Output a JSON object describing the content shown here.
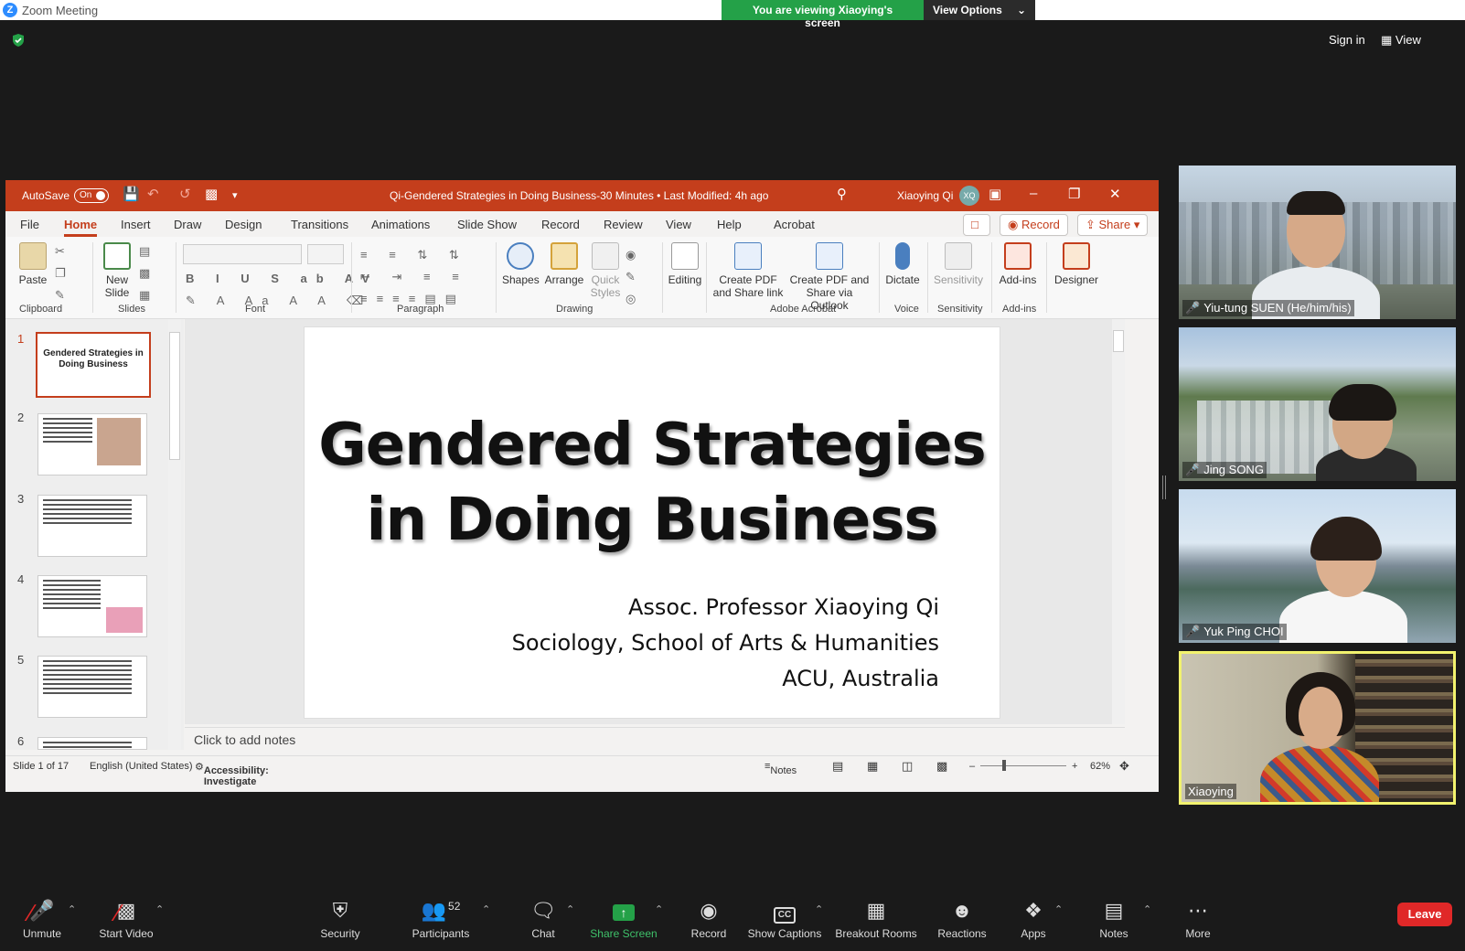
{
  "zoom": {
    "window_title": "Zoom Meeting",
    "viewing_banner": "You are viewing Xiaoying's screen",
    "view_options": "View Options",
    "sign_in": "Sign in",
    "view": "View"
  },
  "ppt": {
    "autosave_label": "AutoSave",
    "autosave_state": "On",
    "doc_title": "Qi-Gendered Strategies in Doing Business-30 Minutes • Last Modified: 4h ago",
    "user_name": "Xiaoying Qi",
    "user_initials": "XQ",
    "menu_tabs": [
      "File",
      "Home",
      "Insert",
      "Draw",
      "Design",
      "Transitions",
      "Animations",
      "Slide Show",
      "Record",
      "Review",
      "View",
      "Help",
      "Acrobat"
    ],
    "record_button": "Record",
    "share_button": "Share",
    "ribbon": {
      "paste": "Paste",
      "new_slide": "New Slide",
      "shapes": "Shapes",
      "arrange": "Arrange",
      "quick_styles": "Quick Styles",
      "editing": "Editing",
      "create_pdf_link": "Create PDF and Share link",
      "create_pdf_outlook": "Create PDF and Share via Outlook",
      "dictate": "Dictate",
      "sensitivity": "Sensitivity",
      "addins": "Add-ins",
      "designer": "Designer",
      "groups": [
        "Clipboard",
        "Slides",
        "Font",
        "Paragraph",
        "Drawing",
        "Adobe Acrobat",
        "Voice",
        "Sensitivity",
        "Add-ins"
      ]
    },
    "thumbnails": [
      {
        "num": "1",
        "title": "Gendered Strategies in Doing Business"
      },
      {
        "num": "2"
      },
      {
        "num": "3"
      },
      {
        "num": "4"
      },
      {
        "num": "5"
      },
      {
        "num": "6"
      }
    ],
    "slide": {
      "title_line1": "Gendered Strategies",
      "title_line2": "in Doing Business",
      "author": "Assoc. Professor Xiaoying Qi",
      "dept": "Sociology, School of Arts & Humanities",
      "inst": "ACU, Australia"
    },
    "notes_placeholder": "Click to add notes",
    "status": {
      "slide_count": "Slide 1 of 17",
      "language": "English (United States)",
      "accessibility": "Accessibility: Investigate",
      "notes": "Notes",
      "zoom": "62%"
    }
  },
  "participants_video": [
    {
      "name": "Yiu-tung SUEN (He/him/his)",
      "muted": true
    },
    {
      "name": "Jing SONG",
      "muted": true
    },
    {
      "name": "Yuk Ping CHOI",
      "muted": true
    },
    {
      "name": "Xiaoying",
      "muted": false
    }
  ],
  "toolbar": {
    "unmute": "Unmute",
    "start_video": "Start Video",
    "security": "Security",
    "participants": "Participants",
    "participants_count": "52",
    "chat": "Chat",
    "share_screen": "Share Screen",
    "record": "Record",
    "show_captions": "Show Captions",
    "breakout_rooms": "Breakout Rooms",
    "reactions": "Reactions",
    "apps": "Apps",
    "notes": "Notes",
    "more": "More",
    "leave": "Leave"
  },
  "colors": {
    "ppt_accent": "#c43e1c",
    "zoom_green": "#24a148",
    "leave_red": "#e02828",
    "active_speaker": "#f2f26e"
  }
}
